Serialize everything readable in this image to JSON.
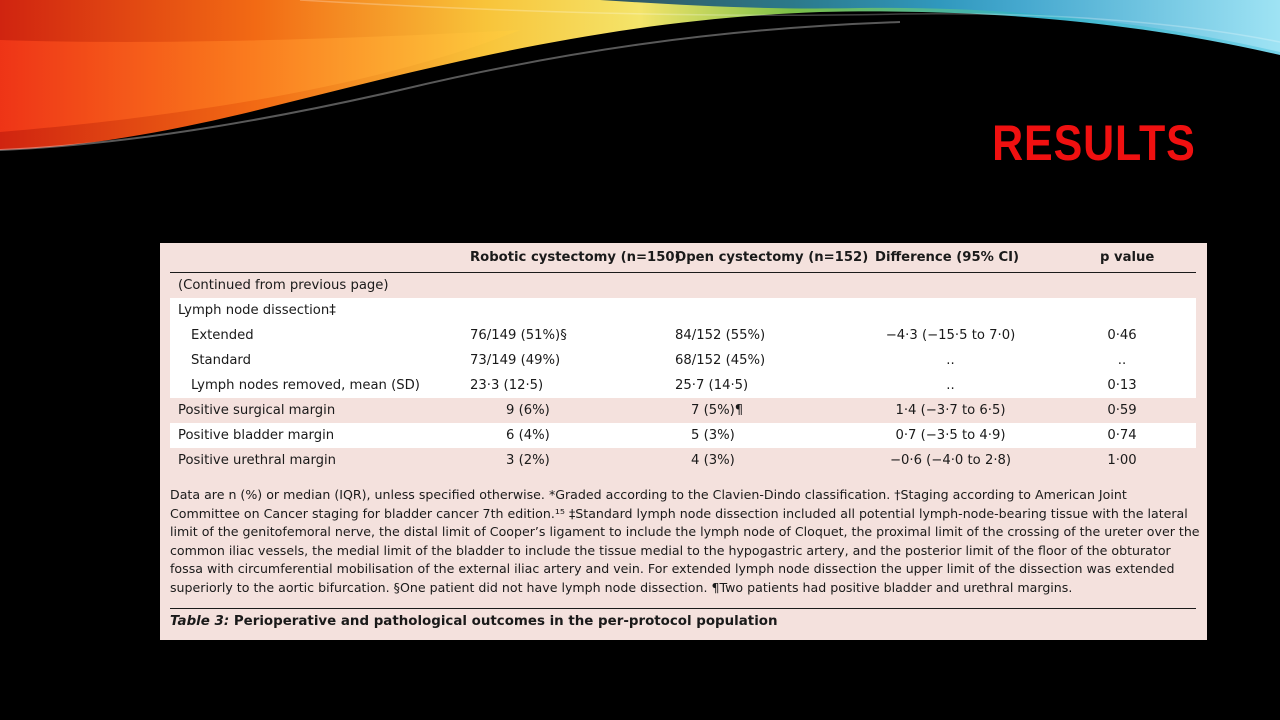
{
  "slide": {
    "title": "RESULTS",
    "colors": {
      "background": "#000000",
      "title": "#f01010",
      "panel": "#f4e1dd"
    },
    "decoration": "swoosh"
  },
  "table": {
    "headers": {
      "label": "",
      "robotic": "Robotic cystectomy (n=150)",
      "open": "Open cystectomy (n=152)",
      "difference": "Difference (95% CI)",
      "pvalue": "p value"
    },
    "continued": "(Continued from previous page)",
    "section_label": "Lymph node dissection‡",
    "rows": [
      {
        "label": "Extended",
        "robotic": "76/149 (51%)§",
        "open": "84/152 (55%)",
        "difference": "−4·3 (−15·5 to 7·0)",
        "pvalue": "0·46"
      },
      {
        "label": "Standard",
        "robotic": "73/149 (49%)",
        "open": "68/152 (45%)",
        "difference": "..",
        "pvalue": ".."
      },
      {
        "label": "Lymph nodes removed, mean (SD)",
        "robotic": "23·3 (12·5)",
        "open": "25·7 (14·5)",
        "difference": "..",
        "pvalue": "0·13"
      },
      {
        "label": "Positive surgical margin",
        "robotic": "9 (6%)",
        "open": "7 (5%)¶",
        "difference": "1·4 (−3·7 to 6·5)",
        "pvalue": "0·59"
      },
      {
        "label": "Positive bladder margin",
        "robotic": "6 (4%)",
        "open": "5 (3%)",
        "difference": "0·7 (−3·5 to 4·9)",
        "pvalue": "0·74"
      },
      {
        "label": "Positive urethral margin",
        "robotic": "3 (2%)",
        "open": "4 (3%)",
        "difference": "−0·6 (−4·0 to 2·8)",
        "pvalue": "1·00"
      }
    ],
    "footnote": "Data are n (%) or median (IQR), unless specified otherwise. *Graded according to the Clavien-Dindo classification. †Staging according to American Joint Committee on Cancer staging for bladder cancer 7th edition.¹⁵ ‡Standard lymph node dissection included all potential lymph-node-bearing tissue with the lateral limit of the genitofemoral nerve, the distal limit of Cooper’s ligament to include the lymph node of Cloquet, the proximal limit of the crossing of the ureter over the common iliac vessels, the medial limit of the bladder to include the tissue medial to the hypogastric artery, and the posterior limit of the floor of the obturator fossa with circumferential mobilisation of the external iliac artery and vein. For extended lymph node dissection the upper limit of the dissection was extended superiorly to the aortic bifurcation. §One patient did not have lymph node dissection. ¶Two patients had positive bladder and urethral margins.",
    "caption_label": "Table 3:",
    "caption_text": " Perioperative and pathological outcomes in the per-protocol population"
  }
}
